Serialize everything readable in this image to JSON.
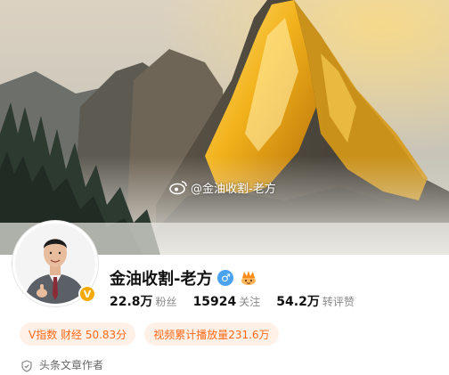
{
  "cover": {
    "watermark_text": "@金油收割-老方",
    "watermark_icon": "weibo-icon"
  },
  "profile": {
    "nickname": "金油收割-老方",
    "gender_icon": "male-icon",
    "gender_symbol": "♂",
    "badge_icon": "crown-icon",
    "verified_badge": "V",
    "verified_color": "#f5a800"
  },
  "stats": [
    {
      "value": "22.8万",
      "label": "粉丝"
    },
    {
      "value": "15924",
      "label": "关注"
    },
    {
      "value": "54.2万",
      "label": "转评赞"
    }
  ],
  "tags": [
    {
      "text": "V指数 财经 50.83分"
    },
    {
      "text": "视频累计播放量231.6万"
    }
  ],
  "author": {
    "icon": "shield-icon",
    "label": "头条文章作者"
  },
  "colors": {
    "accent": "#ff6a1a",
    "tag_bg": "#fff1e8",
    "gender": "#4aa3f0"
  }
}
